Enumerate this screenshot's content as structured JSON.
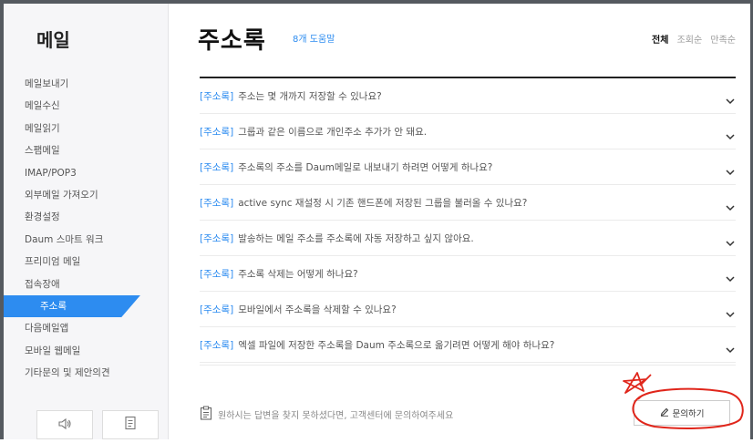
{
  "sidebar": {
    "title": "메일",
    "items": [
      {
        "label": "메일보내기",
        "active": false
      },
      {
        "label": "메일수신",
        "active": false
      },
      {
        "label": "메일읽기",
        "active": false
      },
      {
        "label": "스팸메일",
        "active": false
      },
      {
        "label": "IMAP/POP3",
        "active": false
      },
      {
        "label": "외부메일 가져오기",
        "active": false
      },
      {
        "label": "환경설정",
        "active": false
      },
      {
        "label": "Daum 스마트 워크",
        "active": false
      },
      {
        "label": "프리미엄 메일",
        "active": false
      },
      {
        "label": "접속장애",
        "active": false
      },
      {
        "label": "주소록",
        "active": true
      },
      {
        "label": "다음메일앱",
        "active": false
      },
      {
        "label": "모바일 웹메일",
        "active": false
      },
      {
        "label": "기타문의 및 제안의견",
        "active": false
      }
    ],
    "buttons": [
      {
        "icon": "speaker-icon"
      },
      {
        "icon": "document-icon"
      }
    ]
  },
  "header": {
    "title": "주소록",
    "help_count": "8개",
    "help_label": "도움말",
    "sort": [
      {
        "label": "전체",
        "active": true
      },
      {
        "label": "조회순",
        "active": false
      },
      {
        "label": "만족순",
        "active": false
      }
    ]
  },
  "faq": [
    {
      "category": "[주소록]",
      "question": "주소는 몇 개까지 저장할 수 있나요?"
    },
    {
      "category": "[주소록]",
      "question": "그룹과 같은 이름으로 개인주소 추가가 안 돼요."
    },
    {
      "category": "[주소록]",
      "question": "주소록의 주소를 Daum메일로 내보내기 하려면 어떻게 하나요?"
    },
    {
      "category": "[주소록]",
      "question": "active sync 재설정 시 기존 핸드폰에 저장된 그룹을 불러올 수 있나요?"
    },
    {
      "category": "[주소록]",
      "question": "발송하는 메일 주소를 주소록에 자동 저장하고 싶지 않아요."
    },
    {
      "category": "[주소록]",
      "question": "주소록 삭제는 어떻게 하나요?"
    },
    {
      "category": "[주소록]",
      "question": "모바일에서 주소록을 삭제할 수 있나요?"
    },
    {
      "category": "[주소록]",
      "question": "엑셀 파일에 저장한 주소록을 Daum 주소록으로 옮기려면 어떻게 해야 하나요?"
    }
  ],
  "footer": {
    "note": "원하시는 답변을 찾지 못하셨다면, 고객센터에 문의하여주세요",
    "ask_label": "문의하기",
    "note_icon": "clipboard-icon",
    "ask_icon": "pencil-icon"
  },
  "colors": {
    "accent": "#2d8cf0",
    "annotation": "#e0261b",
    "frame": "#555a60"
  }
}
